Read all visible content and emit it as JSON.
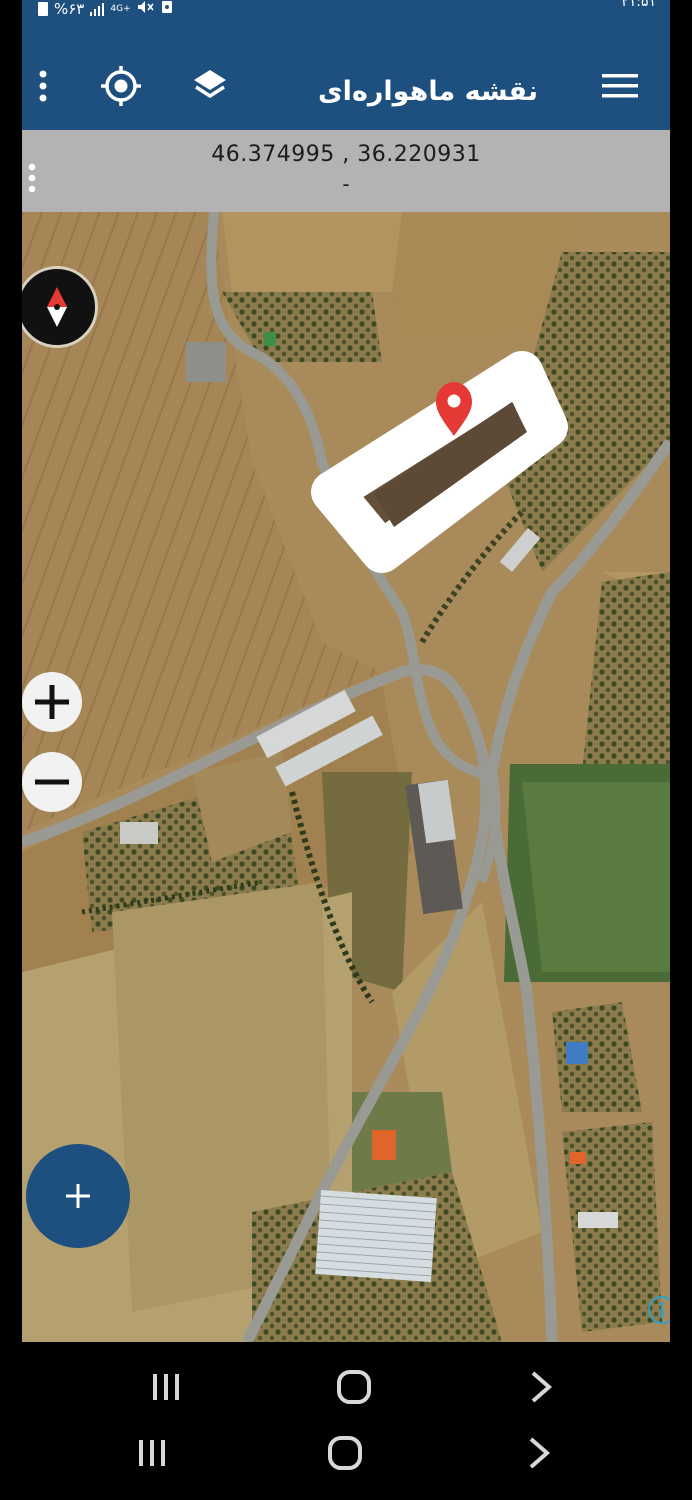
{
  "status_bar": {
    "battery": "%۶۳",
    "network": "4G+",
    "time": "۲۱:۵۱"
  },
  "app_bar": {
    "title": "نقشه ماهواره‌ای",
    "icons": [
      "more-vertical-icon",
      "my-location-icon",
      "layers-icon",
      "hamburger-menu-icon"
    ]
  },
  "coordinates": {
    "value": "46.374995 , 36.220931",
    "sub": "-"
  },
  "map": {
    "type": "satellite",
    "controls": {
      "zoom_in": "+",
      "zoom_out": "−",
      "fab": "+",
      "compass": "compass-icon",
      "info": "info-icon"
    },
    "marker": "location-pin-icon",
    "colors": {
      "accent": "#1d4f7f",
      "marker": "#e53935",
      "outline": "#ffffff"
    }
  },
  "nav_bars": [
    {
      "recents": "recents-icon",
      "home": "home-icon",
      "back": "back-icon"
    },
    {
      "recents": "recents-icon",
      "home": "home-icon",
      "back": "back-icon"
    }
  ]
}
